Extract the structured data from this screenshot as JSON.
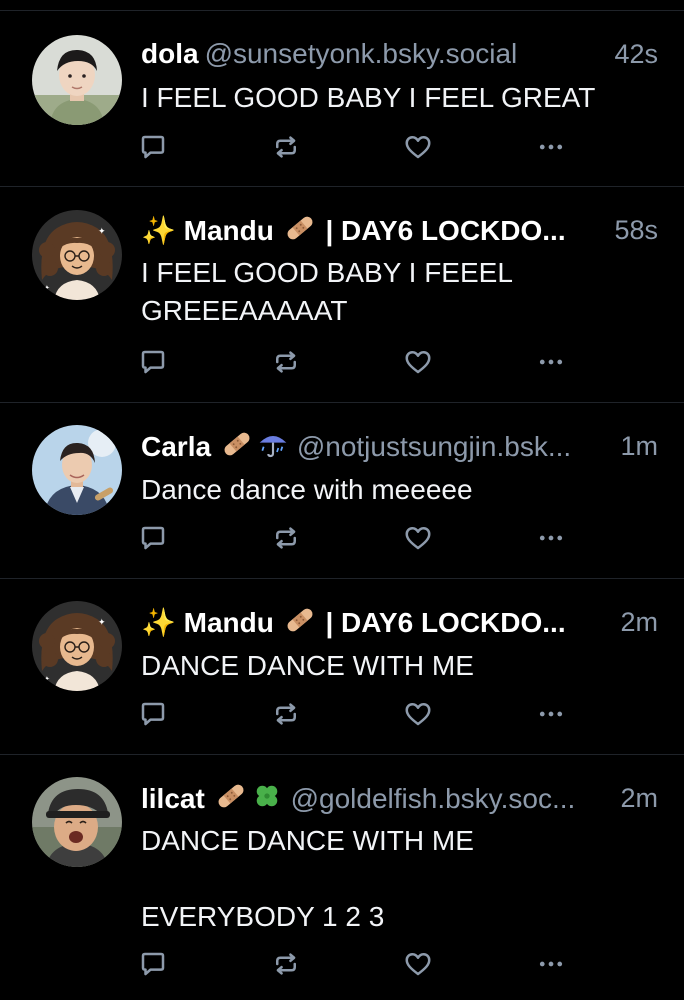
{
  "colors": {
    "background": "#000000",
    "text": "#f2f4f7",
    "muted": "#8d9aab",
    "divider": "#1f2329"
  },
  "icons": {
    "reply": "speech-bubble-icon",
    "repost": "repost-icon",
    "like": "heart-outline-icon",
    "more": "ellipsis-icon"
  },
  "posts": [
    {
      "name": "dola",
      "handle": "@sunsetyonk.bsky.social",
      "time": "42s",
      "text": "I FEEL GOOD BABY I FEEL GREAT"
    },
    {
      "name_prefix": "✨",
      "name": "Mandu",
      "name_suffix": "| DAY6 LOCKDO...",
      "time": "58s",
      "text": "I FEEL GOOD BABY I FEEEL\nGREEEAAAAAT"
    },
    {
      "name": "Carla",
      "handle": "@notjustsungjin.bsk...",
      "time": "1m",
      "text": "Dance dance with meeeee"
    },
    {
      "name_prefix": "✨",
      "name": "Mandu",
      "name_suffix": "| DAY6 LOCKDO...",
      "time": "2m",
      "text": "DANCE DANCE WITH ME"
    },
    {
      "name": "lilcat",
      "handle": "@goldelfish.bsky.soc...",
      "time": "2m",
      "text": "DANCE DANCE WITH ME\n\nEVERYBODY 1 2 3"
    }
  ]
}
